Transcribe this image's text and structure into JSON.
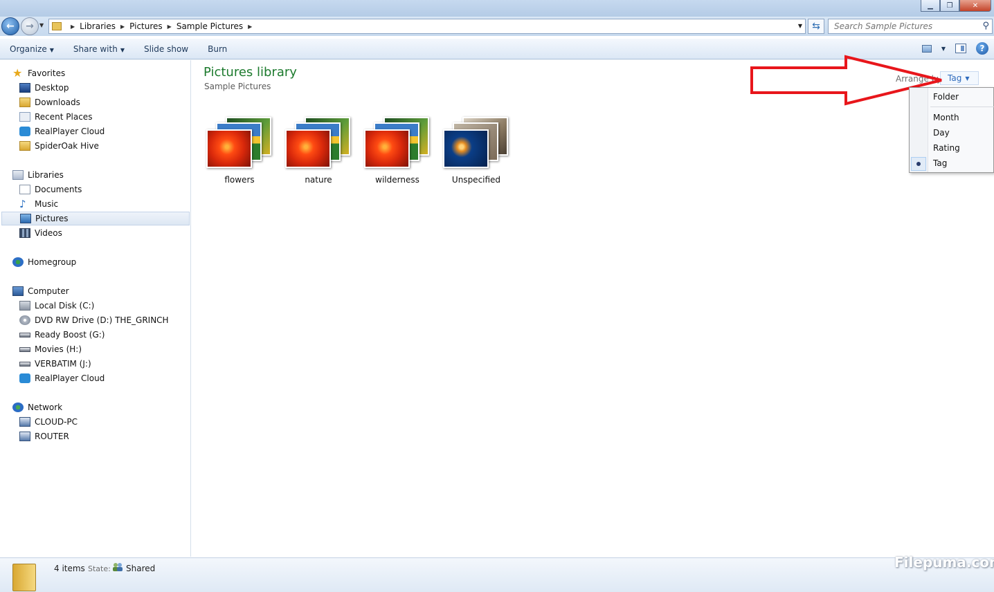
{
  "window": {
    "minimize_glyph": "▁",
    "maximize_glyph": "❐",
    "close_glyph": "✕"
  },
  "address": {
    "crumbs": [
      "Libraries",
      "Pictures",
      "Sample Pictures"
    ],
    "search_placeholder": "Search Sample Pictures"
  },
  "toolbar": {
    "organize": "Organize",
    "share_with": "Share with",
    "slide_show": "Slide show",
    "burn": "Burn"
  },
  "nav": {
    "favorites": "Favorites",
    "desktop": "Desktop",
    "downloads": "Downloads",
    "recent_places": "Recent Places",
    "realplayer_cloud": "RealPlayer Cloud",
    "spideroak_hive": "SpiderOak Hive",
    "libraries": "Libraries",
    "documents": "Documents",
    "music": "Music",
    "pictures": "Pictures",
    "videos": "Videos",
    "homegroup": "Homegroup",
    "computer": "Computer",
    "local_disk": "Local Disk (C:)",
    "dvd_drive": "DVD RW Drive (D:) THE_GRINCH",
    "ready_boost": "Ready Boost (G:)",
    "movies": "Movies (H:)",
    "verbatim": "VERBATIM (J:)",
    "realplayer_cloud_2": "RealPlayer Cloud",
    "network": "Network",
    "cloud_pc": "CLOUD-PC",
    "router": "ROUTER"
  },
  "content": {
    "title": "Pictures library",
    "subtitle": "Sample Pictures",
    "arrange_label": "Arrange by:",
    "arrange_value": "Tag",
    "stacks": [
      "flowers",
      "nature",
      "wilderness",
      "Unspecified"
    ]
  },
  "arrange_menu": {
    "items": [
      "Folder",
      "Month",
      "Day",
      "Rating",
      "Tag"
    ],
    "selected": "Tag"
  },
  "status": {
    "count": "4 items",
    "state_label": "State:",
    "state_value": "Shared"
  },
  "watermark": "Filepuma.com",
  "colors": {
    "title_green": "#1c7a2d",
    "link_blue": "#2e6bbd",
    "annotation_red": "#e8161b"
  }
}
